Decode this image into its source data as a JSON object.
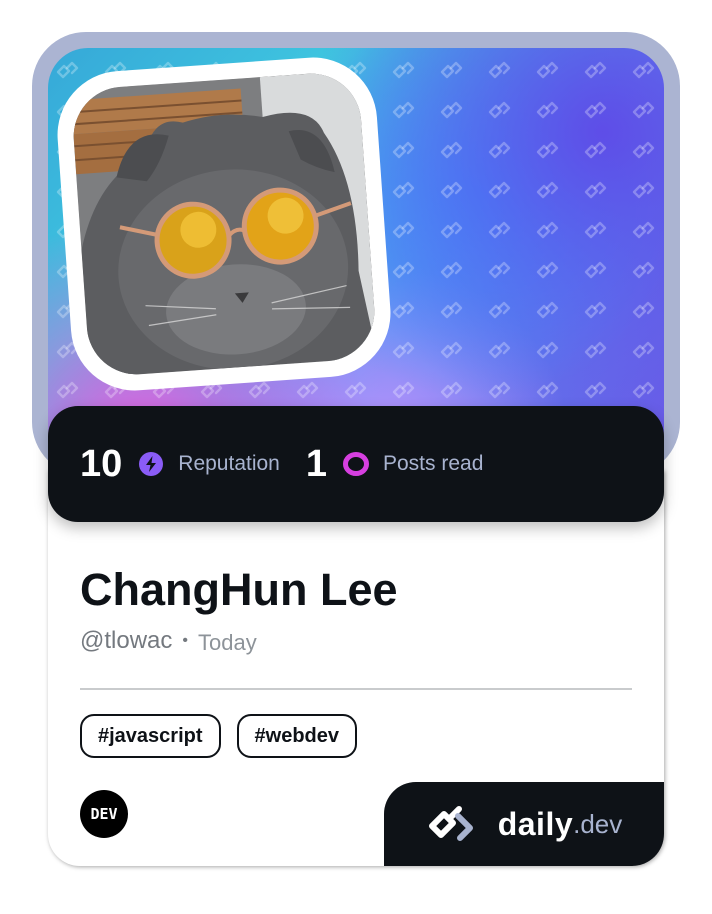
{
  "profile": {
    "name": "ChangHun Lee",
    "handle": "@tlowac",
    "separator": "•",
    "date": "Today",
    "avatar_description": "gray scottish fold cat wearing round yellow sunglasses"
  },
  "stats": {
    "reputation": {
      "value": "10",
      "label": "Reputation",
      "icon": "lightning-icon",
      "color": "#8a5cf6"
    },
    "posts": {
      "value": "1",
      "label": "Posts read",
      "icon": "ring-icon",
      "color": "#d63fe0"
    }
  },
  "tags": [
    "#javascript",
    "#webdev"
  ],
  "source": {
    "badge": "DEV"
  },
  "brand": {
    "word": "daily",
    "tld": ".dev",
    "icon": "daily-dev-logo-icon"
  },
  "colors": {
    "dark": "#0e1217",
    "frame": "#abb4d2",
    "muted_label": "#a8b3cf"
  }
}
